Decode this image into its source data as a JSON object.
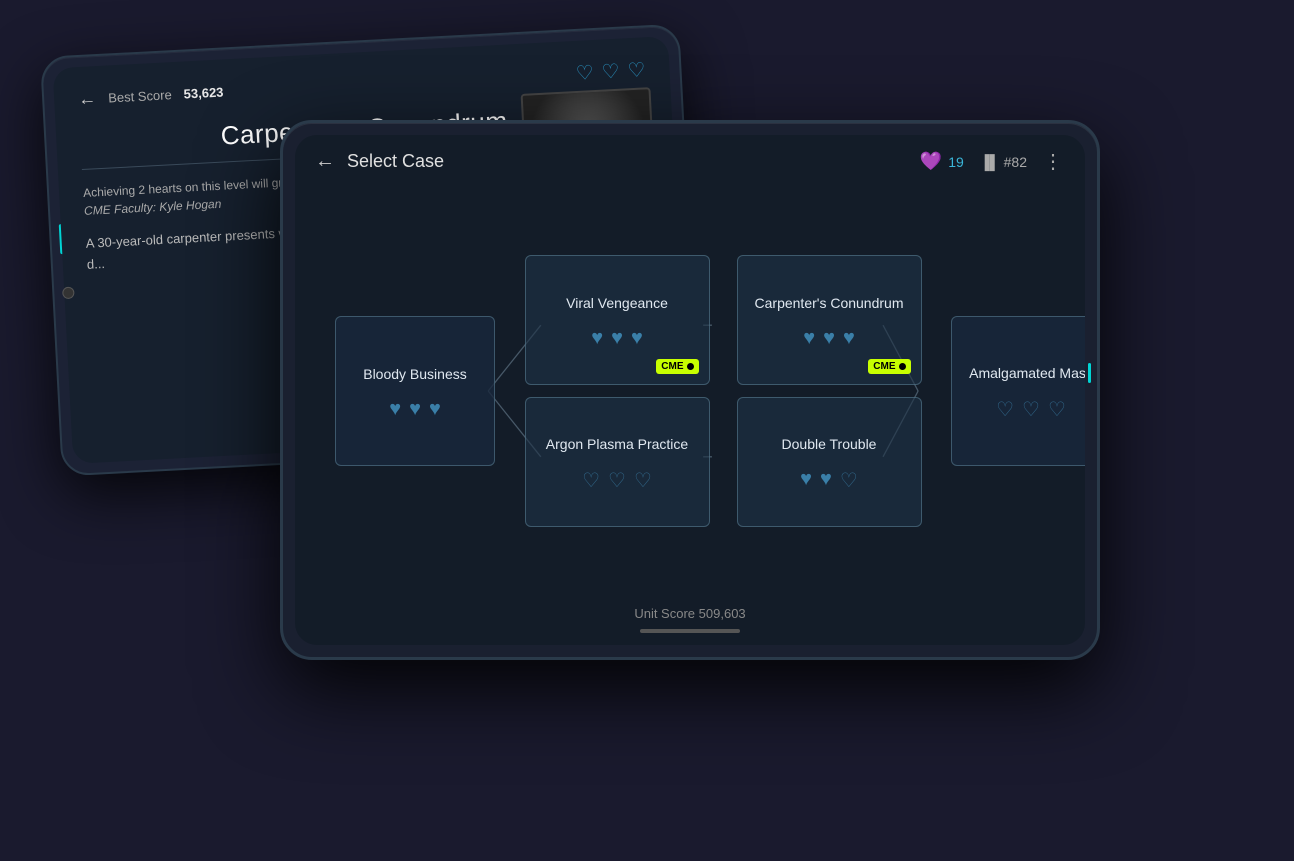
{
  "scene": {
    "bg_color": "#1a1a2e"
  },
  "back_tablet": {
    "header": {
      "back_label": "←",
      "score_label": "Best Score",
      "score_value": "53,623",
      "hearts": [
        "♡",
        "♡",
        "♡"
      ]
    },
    "title": "Carpenter's Conundrum",
    "cme_note": "Achieving 2 hearts on this level will grant CME credit",
    "cme_faculty": "CME Faculty: Kyle Hogan",
    "body_text": "A 30-year-old carpenter presents with shortness of breath and cough after... history of pulmonary d..."
  },
  "front_tablet": {
    "header": {
      "back_label": "←",
      "title": "Select Case",
      "hearts_count": "19",
      "rank": "#82",
      "more_icon": "⋮"
    },
    "cases": [
      {
        "id": "bloody-business",
        "title": "Bloody Business",
        "hearts": 3,
        "hearts_filled": 3,
        "cme": false,
        "position": "left"
      },
      {
        "id": "viral-vengeance",
        "title": "Viral Vengeance",
        "hearts": 3,
        "hearts_filled": 3,
        "cme": true,
        "cme_label": "CME",
        "position": "top-center-left"
      },
      {
        "id": "carpenters-conundrum",
        "title": "Carpenter's Conundrum",
        "hearts": 3,
        "hearts_filled": 3,
        "cme": true,
        "cme_label": "CME",
        "position": "top-center-right"
      },
      {
        "id": "argon-plasma",
        "title": "Argon Plasma Practice",
        "hearts": 3,
        "hearts_filled": 0,
        "cme": false,
        "position": "bottom-center-left"
      },
      {
        "id": "double-trouble",
        "title": "Double Trouble",
        "hearts": 3,
        "hearts_filled": 2,
        "cme": false,
        "position": "bottom-center-right"
      },
      {
        "id": "amalgamated-mass",
        "title": "Amalgamated Mass",
        "hearts": 3,
        "hearts_filled": 0,
        "cme": false,
        "position": "right"
      }
    ],
    "footer": {
      "unit_score_label": "Unit Score",
      "unit_score_value": "509,603"
    }
  }
}
